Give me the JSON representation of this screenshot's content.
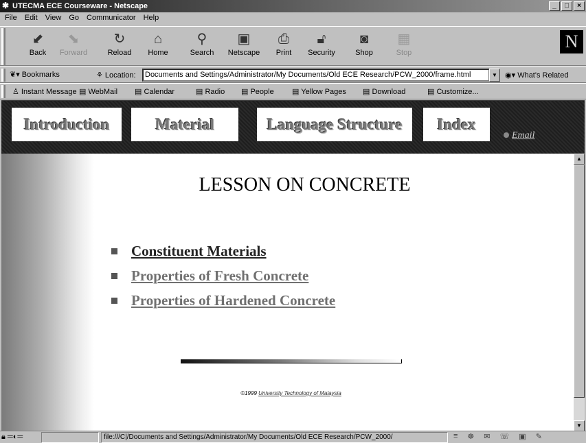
{
  "window": {
    "title": "UTECMA ECE Courseware - Netscape",
    "controls": [
      "_",
      "□",
      "×"
    ]
  },
  "menu": [
    "File",
    "Edit",
    "View",
    "Go",
    "Communicator",
    "Help"
  ],
  "toolbar": {
    "buttons": [
      {
        "label": "Back",
        "icon": "back-arrow-icon",
        "disabled": false
      },
      {
        "label": "Forward",
        "icon": "forward-arrow-icon",
        "disabled": true
      },
      {
        "label": "Reload",
        "icon": "reload-icon",
        "disabled": false
      },
      {
        "label": "Home",
        "icon": "home-icon",
        "disabled": false
      },
      {
        "label": "Search",
        "icon": "search-icon",
        "disabled": false
      },
      {
        "label": "Netscape",
        "icon": "netscape-icon",
        "disabled": false
      },
      {
        "label": "Print",
        "icon": "print-icon",
        "disabled": false
      },
      {
        "label": "Security",
        "icon": "lock-icon",
        "disabled": false
      },
      {
        "label": "Shop",
        "icon": "shop-icon",
        "disabled": false
      },
      {
        "label": "Stop",
        "icon": "stop-icon",
        "disabled": true
      }
    ],
    "logo": "N"
  },
  "location": {
    "bookmarks_label": "Bookmarks",
    "label": "Location:",
    "url": "Documents and Settings/Administrator/My Documents/Old ECE Research/PCW_2000/frame.html",
    "related_label": "What's Related"
  },
  "personal": [
    "Instant Message",
    "WebMail",
    "Calendar",
    "Radio",
    "People",
    "Yellow Pages",
    "Download",
    "Customize..."
  ],
  "nav": {
    "buttons": [
      "Introduction",
      "Material",
      "Language Structure",
      "Index"
    ],
    "email": "Email"
  },
  "page": {
    "title": "LESSON ON CONCRETE",
    "links": [
      {
        "text": "Constituent Materials",
        "color": "#222222"
      },
      {
        "text": "Properties of Fresh Concrete",
        "color": "#707070"
      },
      {
        "text": "Properties of Hardened Concrete",
        "color": "#707070"
      }
    ],
    "copyright_prefix": "©1999 ",
    "copyright_link": "University Technology of Malaysia"
  },
  "status": {
    "url": "file:///C|/Documents and Settings/Administrator/My Documents/Old ECE Research/PCW_2000/"
  }
}
